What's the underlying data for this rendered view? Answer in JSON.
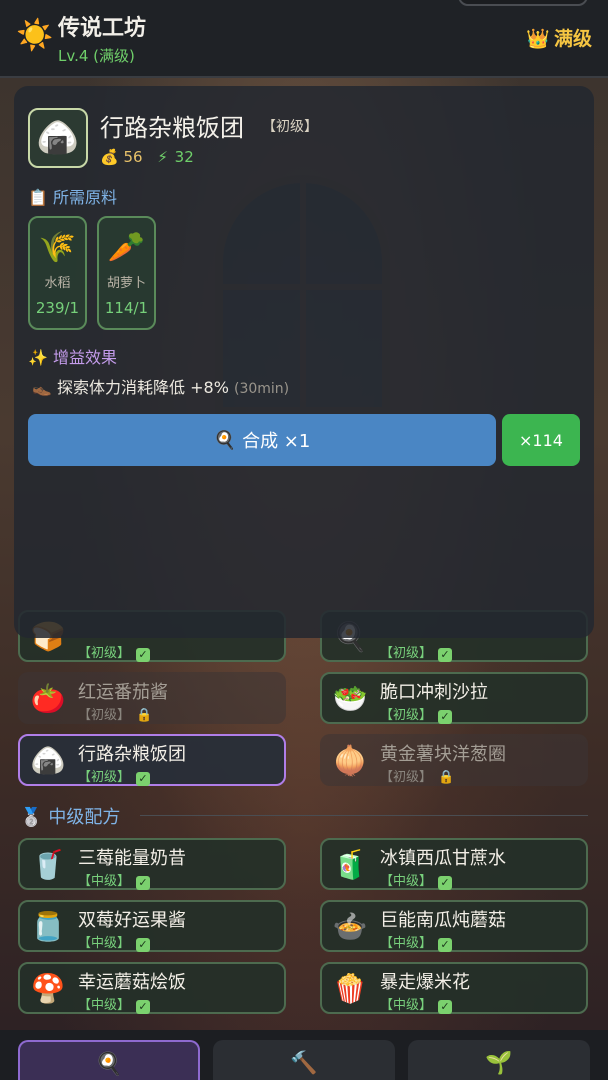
{
  "header": {
    "title": "传说工坊",
    "level": "Lv.4 (满级)",
    "max_label": "满级",
    "sun_icon": "☀️",
    "crown_icon": "👑"
  },
  "detail": {
    "icon": "🍙",
    "name": "行路杂粮饭团",
    "tier": "【初级】",
    "gold": "56",
    "energy": "32",
    "ingredients_label": "所需原料",
    "ingredients": [
      {
        "icon": "🌾",
        "name": "水稻",
        "count": "239/1"
      },
      {
        "icon": "🥕",
        "name": "胡萝卜",
        "count": "114/1"
      }
    ],
    "buff_label": "增益效果",
    "buff_text": "探索体力消耗降低 +8%",
    "buff_duration": "(30min)",
    "craft_label": "合成 ×1",
    "craft_max_label": "×114"
  },
  "recipes": [
    {
      "icon": "🍞",
      "name": "",
      "tag": "【初级】",
      "state": "ok"
    },
    {
      "icon": "🍳",
      "name": "",
      "tag": "【初级】",
      "state": "ok"
    },
    {
      "icon": "🍅",
      "name": "红运番茄酱",
      "tag": "【初级】",
      "state": "locked"
    },
    {
      "icon": "🥗",
      "name": "脆口冲刺沙拉",
      "tag": "【初级】",
      "state": "ok"
    },
    {
      "icon": "🍙",
      "name": "行路杂粮饭团",
      "tag": "【初级】",
      "state": "selected"
    },
    {
      "icon": "🧅",
      "name": "黄金薯块洋葱圈",
      "tag": "【初级】",
      "state": "locked"
    },
    {
      "icon": "🥤",
      "name": "三莓能量奶昔",
      "tag": "【中级】",
      "state": "ok"
    },
    {
      "icon": "🧃",
      "name": "冰镇西瓜甘蔗水",
      "tag": "【中级】",
      "state": "ok"
    },
    {
      "icon": "🫙",
      "name": "双莓好运果酱",
      "tag": "【中级】",
      "state": "ok"
    },
    {
      "icon": "🍲",
      "name": "巨能南瓜炖蘑菇",
      "tag": "【中级】",
      "state": "ok"
    },
    {
      "icon": "🍄",
      "name": "幸运蘑菇烩饭",
      "tag": "【中级】",
      "state": "ok"
    },
    {
      "icon": "🍿",
      "name": "暴走爆米花",
      "tag": "【中级】",
      "state": "ok"
    }
  ],
  "mid_tier_label": "中级配方",
  "bottom_nav": [
    {
      "icon": "🍳",
      "active": true
    },
    {
      "icon": "🔨",
      "active": false
    },
    {
      "icon": "🌱",
      "active": false
    }
  ],
  "colors": {
    "accent_green": "#3cb550",
    "accent_blue": "#4a86c4",
    "selected_border": "#b07ee8",
    "gold": "#f5c542"
  }
}
